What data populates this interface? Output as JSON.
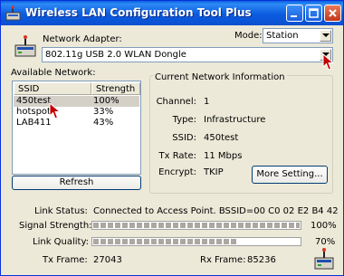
{
  "window": {
    "title": "Wireless LAN Configuration Tool Plus"
  },
  "adapter": {
    "label": "Network Adapter:",
    "value": "802.11g USB 2.0 WLAN Dongle"
  },
  "mode": {
    "label": "Mode:",
    "value": "Station"
  },
  "available": {
    "label": "Available Network:",
    "columns": [
      "SSID",
      "Strength"
    ],
    "rows": [
      {
        "ssid": "450test",
        "strength": "100%"
      },
      {
        "ssid": "hotspot",
        "strength": "33%"
      },
      {
        "ssid": "LAB411",
        "strength": "43%"
      }
    ],
    "refresh_label": "Refresh"
  },
  "current": {
    "title": "Current Network Information",
    "channel_label": "Channel:",
    "channel": "1",
    "type_label": "Type:",
    "type": "Infrastructure",
    "ssid_label": "SSID:",
    "ssid": "450test",
    "rate_label": "Tx Rate:",
    "rate": "11 Mbps",
    "encrypt_label": "Encrypt:",
    "encrypt": "TKIP",
    "more_label": "More Setting..."
  },
  "status": {
    "link_label": "Link Status:",
    "link_value": "Connected to Access Point. BSSID=00 C0 02 E2 B4 42",
    "signal_label": "Signal Strength:",
    "signal_value": "100%",
    "signal_fraction": 1.0,
    "quality_label": "Link Quality:",
    "quality_value": "70%",
    "quality_fraction": 0.7,
    "tx_label": "Tx Frame:",
    "tx_value": "27043",
    "rx_label": "Rx Frame:",
    "rx_value": "85236"
  },
  "colors": {
    "titlebar": "#0a5fdf",
    "frame": "#ece9d8",
    "cursor": "#c00000"
  }
}
